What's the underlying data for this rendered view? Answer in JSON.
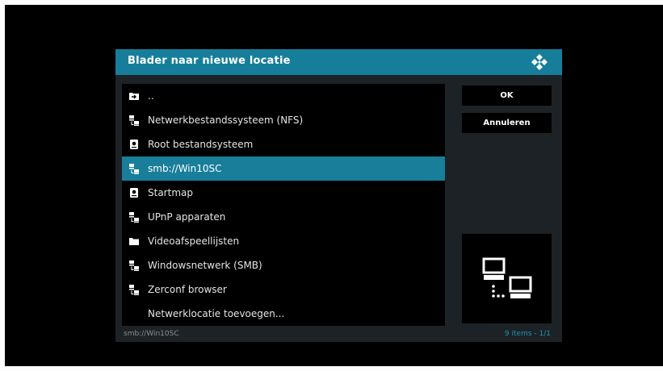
{
  "dialog": {
    "title": "Blader naar nieuwe locatie",
    "logo_icon": "kodi-logo-icon"
  },
  "list": {
    "items": [
      {
        "label": "..",
        "icon": "folder-up-icon"
      },
      {
        "label": "Netwerkbestandssysteem (NFS)",
        "icon": "network-icon"
      },
      {
        "label": "Root bestandsysteem",
        "icon": "drive-icon"
      },
      {
        "label": "smb://Win10SC",
        "icon": "network-icon",
        "selected": true
      },
      {
        "label": "Startmap",
        "icon": "drive-icon"
      },
      {
        "label": "UPnP apparaten",
        "icon": "network-icon"
      },
      {
        "label": "Videoafspeellijsten",
        "icon": "folder-icon"
      },
      {
        "label": "Windowsnetwerk (SMB)",
        "icon": "network-icon"
      },
      {
        "label": "Zerconf browser",
        "icon": "network-icon"
      },
      {
        "label": "Netwerklocatie toevoegen...",
        "icon": ""
      }
    ]
  },
  "buttons": {
    "ok": "OK",
    "cancel": "Annuleren"
  },
  "preview": {
    "icon": "network-computers-icon"
  },
  "footer": {
    "path": "smb://Win10SC",
    "count": "9 items - 1/1"
  },
  "colors": {
    "accent": "#167e9b",
    "selected_row": "#187e9a",
    "panel": "#1c2225",
    "count_text": "#1e93b5"
  }
}
